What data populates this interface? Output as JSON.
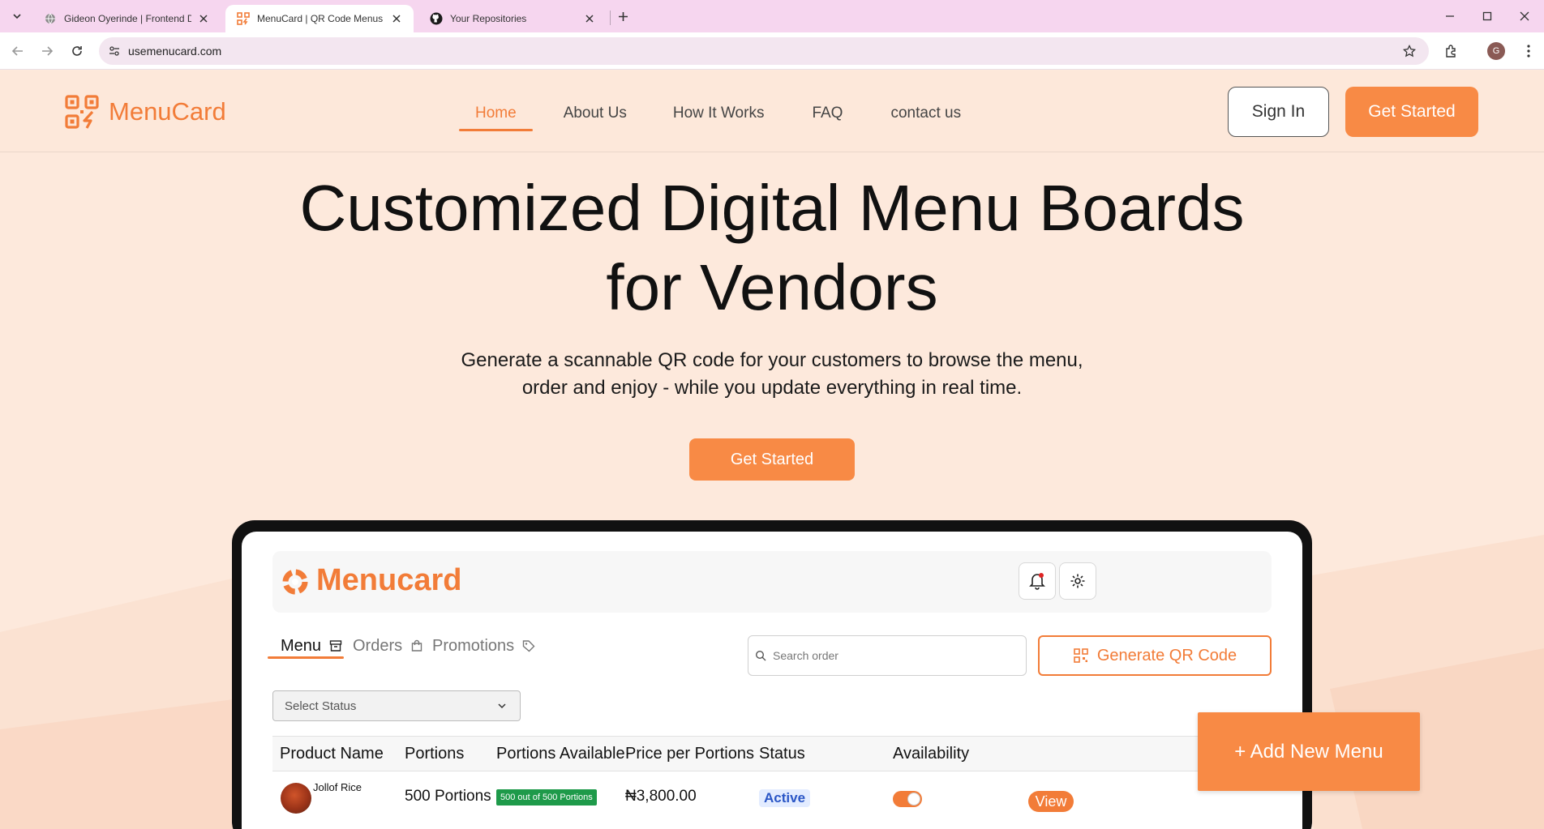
{
  "browser": {
    "tabs": [
      {
        "title": "Gideon Oyerinde | Frontend De",
        "active": false
      },
      {
        "title": "MenuCard | QR Code Menus &",
        "active": true
      },
      {
        "title": "Your Repositories",
        "active": false
      }
    ],
    "url": "usemenucard.com",
    "profile_initial": "G"
  },
  "header": {
    "brand": "MenuCard",
    "nav": [
      "Home",
      "About Us",
      "How It Works",
      "FAQ",
      "contact us"
    ],
    "active_nav": "Home",
    "sign_in": "Sign In",
    "get_started": "Get Started"
  },
  "hero": {
    "title_line1": "Customized Digital Menu Boards",
    "title_line2": "for Vendors",
    "subtitle_line1": "Generate a scannable QR code for your customers to browse the menu,",
    "subtitle_line2": "order and enjoy - while you update everything in real time.",
    "cta": "Get Started"
  },
  "dashboard": {
    "app_name": "Menucard",
    "tabs": [
      "Menu",
      "Orders",
      "Promotions"
    ],
    "active_tab": "Menu",
    "search_placeholder": "Search order",
    "generate_qr": "Generate QR Code",
    "select_status": "Select Status",
    "add_new_menu": "+ Add New Menu",
    "columns": [
      "Product Name",
      "Portions",
      "Portions Available",
      "Price per Portions",
      "Status",
      "Availability"
    ],
    "rows": [
      {
        "product": "Jollof Rice",
        "portions": "500 Portions",
        "available": "500 out of 500 Portions",
        "price": "₦3,800.00",
        "status": "Active",
        "available_toggle": true,
        "action": "View"
      }
    ]
  },
  "colors": {
    "accent": "#f27c38",
    "button": "#f88a45",
    "page_bg": "#fde9dc",
    "tabbar_bg": "#f6d6ef"
  }
}
